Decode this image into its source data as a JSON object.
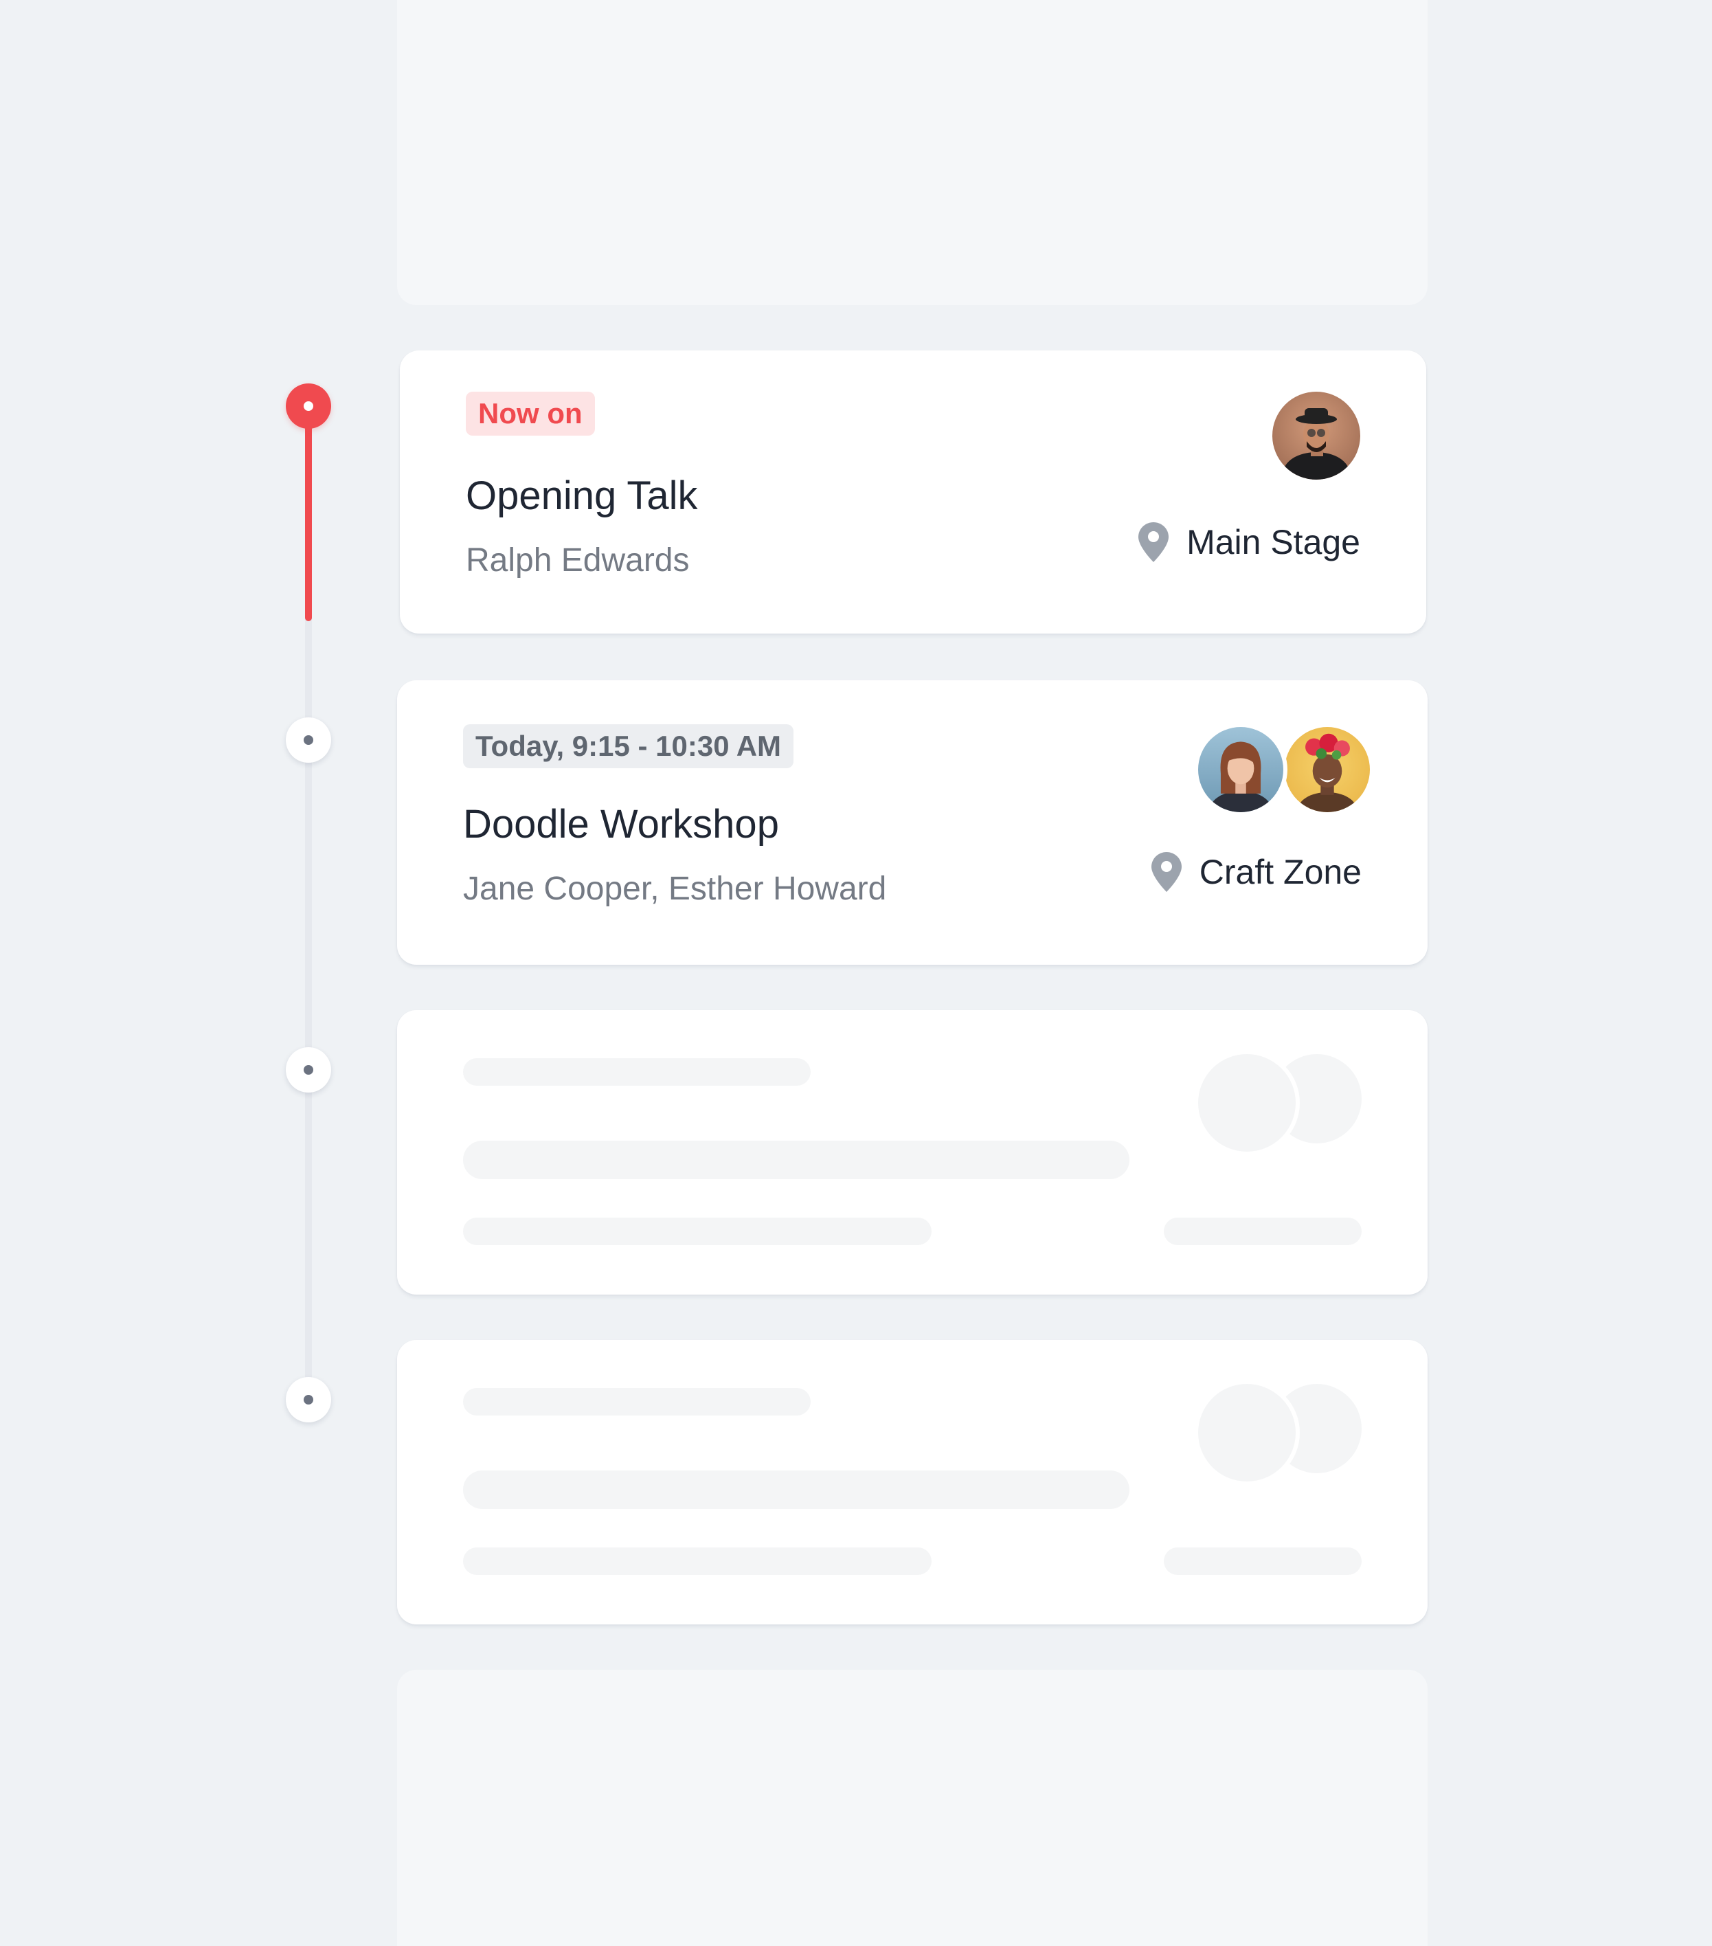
{
  "events": [
    {
      "status_badge": "Now on",
      "title": "Opening Talk",
      "speakers": "Ralph Edwards",
      "location": "Main Stage",
      "state": "live"
    },
    {
      "status_badge": "Today, 9:15 - 10:30 AM",
      "title": "Doodle Workshop",
      "speakers": "Jane Cooper, Esther Howard",
      "location": "Craft Zone",
      "state": "upcoming"
    }
  ],
  "colors": {
    "accent": "#f04a4f",
    "accent_soft": "#fde3e4",
    "background": "#eff2f5",
    "text_primary": "#1f2633",
    "text_secondary": "#747a84"
  },
  "icons": [
    "map-pin-icon"
  ]
}
